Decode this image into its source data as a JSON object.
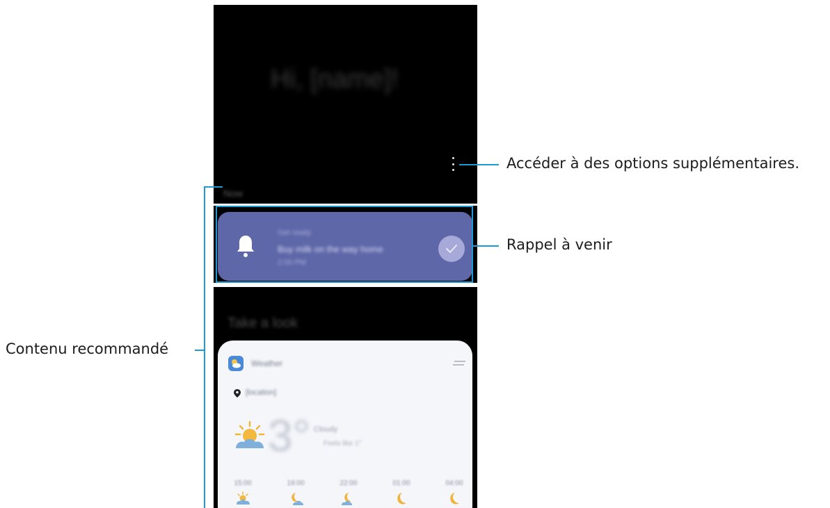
{
  "screen": {
    "greeting": "Hi, [name]!",
    "section_now": "Now",
    "reminder": {
      "label": "Get ready",
      "title": "Buy milk on the way home",
      "time": "2:00 PM"
    },
    "section_look": "Take a look",
    "weather": {
      "app_name": "Weather",
      "location": "[location]",
      "temperature": "3°",
      "desc1": "Cloudy",
      "desc2": "Feels like 1°",
      "hourly": [
        {
          "time": "15:00",
          "icon": "sun-cloud-icon"
        },
        {
          "time": "19:00",
          "icon": "moon-cloud-icon"
        },
        {
          "time": "22:00",
          "icon": "moon-cloud-icon"
        },
        {
          "time": "01:00",
          "icon": "moon-icon"
        },
        {
          "time": "04:00",
          "icon": "moon-icon"
        }
      ]
    }
  },
  "annotations": {
    "more_options": "Accéder à des options supplémentaires.",
    "upcoming_reminder": "Rappel à venir",
    "recommended_content": "Contenu recommandé"
  },
  "colors": {
    "callout": "#1b9ad6",
    "reminder_card": "#5e67a8",
    "weather_card": "#f4f6fa"
  }
}
